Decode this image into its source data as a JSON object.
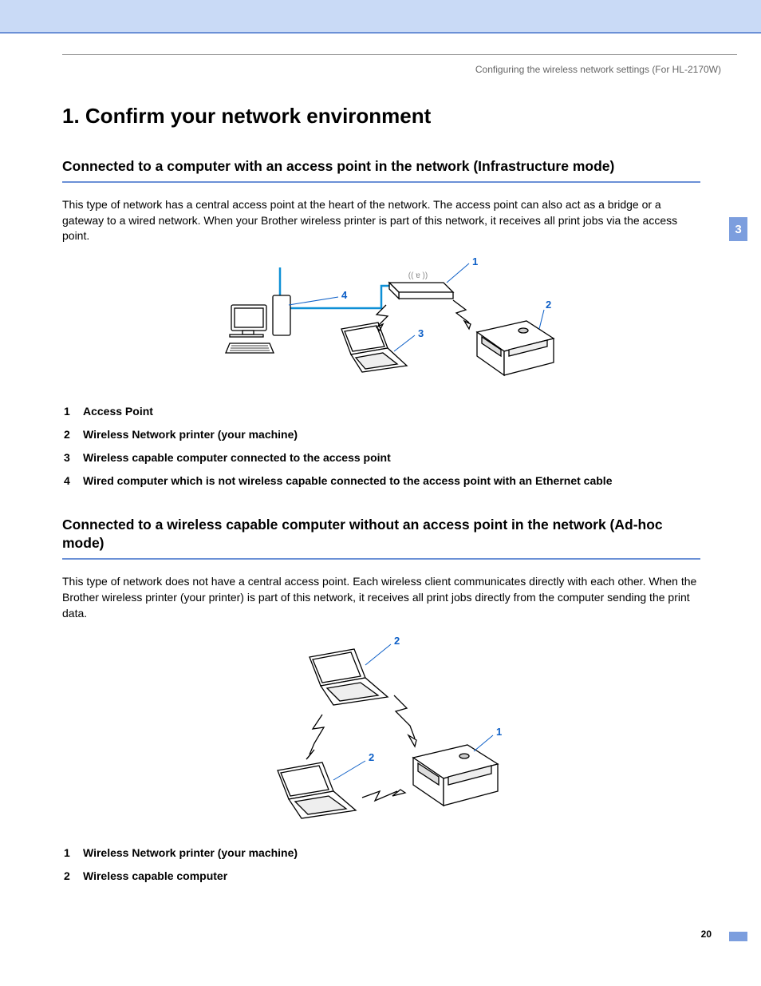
{
  "header": {
    "breadcrumb": "Configuring the wireless network settings (For HL-2170W)",
    "chapter_tab": "3"
  },
  "page": {
    "number": "20"
  },
  "section": {
    "title": "1. Confirm your network environment"
  },
  "infra": {
    "heading": "Connected to a computer with an access point in the network (Infrastructure mode)",
    "paragraph": "This type of network has a central access point at the heart of the network. The access point can also act as a bridge or a gateway to a wired network. When your Brother wireless printer is part of this network, it receives all print jobs via the access point.",
    "diagram_labels": {
      "ap": "1",
      "printer": "2",
      "laptop": "3",
      "desktop": "4"
    },
    "legend": [
      {
        "num": "1",
        "text": "Access Point"
      },
      {
        "num": "2",
        "text": "Wireless Network printer (your machine)"
      },
      {
        "num": "3",
        "text": "Wireless capable computer connected to the access point"
      },
      {
        "num": "4",
        "text": "Wired computer which is not wireless capable connected to the access point with an Ethernet cable"
      }
    ]
  },
  "adhoc": {
    "heading": "Connected to a wireless capable computer without an access point in the network (Ad-hoc mode)",
    "paragraph": "This type of network does not have a central access point. Each wireless client communicates directly with each other. When the Brother wireless printer (your printer) is part of this network, it receives all print jobs directly from the computer sending the print data.",
    "diagram_labels": {
      "printer": "1",
      "laptop_top": "2",
      "laptop_bottom": "2"
    },
    "legend": [
      {
        "num": "1",
        "text": "Wireless Network printer (your machine)"
      },
      {
        "num": "2",
        "text": "Wireless capable computer"
      }
    ]
  }
}
